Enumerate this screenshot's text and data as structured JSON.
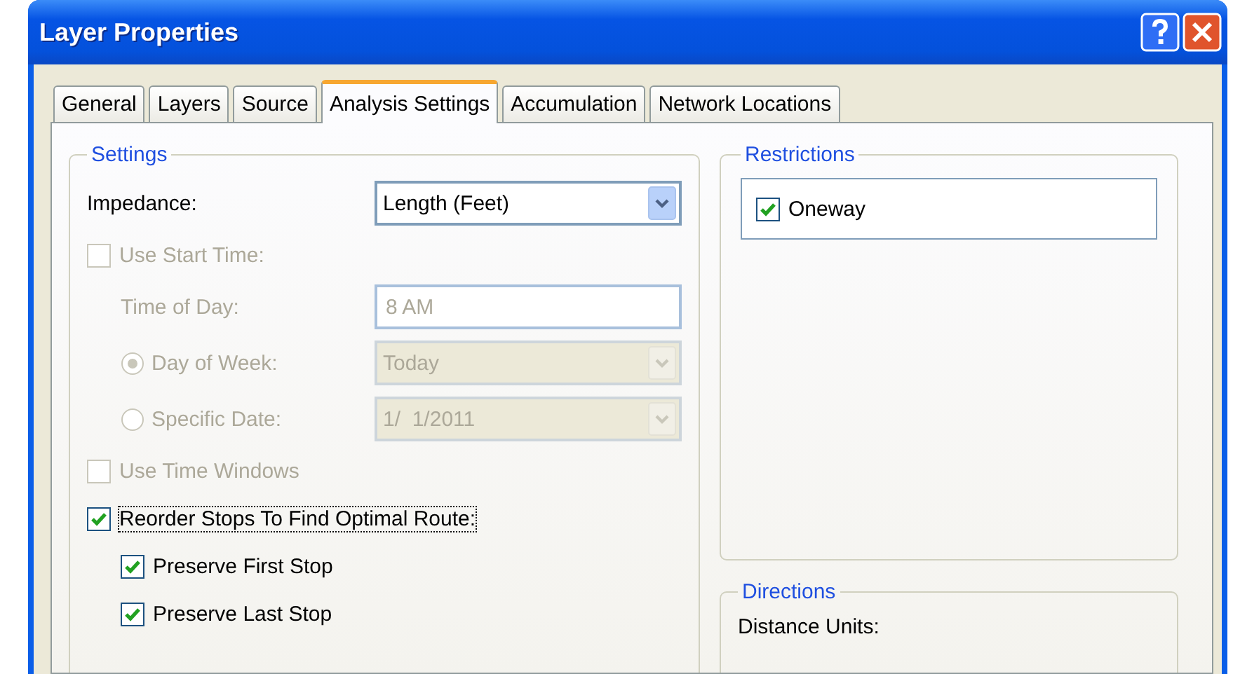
{
  "window": {
    "title": "Layer Properties"
  },
  "tabs": [
    {
      "label": "General",
      "selected": false
    },
    {
      "label": "Layers",
      "selected": false
    },
    {
      "label": "Source",
      "selected": false
    },
    {
      "label": "Analysis Settings",
      "selected": true
    },
    {
      "label": "Accumulation",
      "selected": false
    },
    {
      "label": "Network Locations",
      "selected": false
    }
  ],
  "settings": {
    "title": "Settings",
    "rows": [
      {
        "kind": "combo",
        "label": "Impedance:",
        "value": "Length (Feet)",
        "disabled": false
      },
      {
        "kind": "checkbox",
        "label": "Use Start Time:",
        "checked": false,
        "disabled": true,
        "focused": false,
        "children": [
          {
            "kind": "text",
            "label": "Time of Day:",
            "value": "8 AM",
            "disabled": true
          },
          {
            "kind": "radio-combo",
            "label": "Day of Week:",
            "value": "Today",
            "selected": true,
            "disabled": true
          },
          {
            "kind": "radio-combo",
            "label": "Specific Date:",
            "value": "1/  1/2011",
            "selected": false,
            "disabled": true
          }
        ]
      },
      {
        "kind": "checkbox",
        "label": "Use Time Windows",
        "checked": false,
        "disabled": true,
        "focused": false
      },
      {
        "kind": "checkbox",
        "label": "Reorder Stops To Find Optimal Route:",
        "checked": true,
        "disabled": false,
        "focused": true,
        "children": [
          {
            "kind": "checkbox",
            "label": "Preserve First Stop",
            "checked": true,
            "disabled": false,
            "focused": false
          },
          {
            "kind": "checkbox",
            "label": "Preserve Last Stop",
            "checked": true,
            "disabled": false,
            "focused": false
          }
        ]
      }
    ]
  },
  "restrictions": {
    "title": "Restrictions",
    "items": [
      {
        "label": "Oneway",
        "checked": true
      }
    ]
  },
  "directions": {
    "title": "Directions",
    "label": "Distance Units:"
  }
}
